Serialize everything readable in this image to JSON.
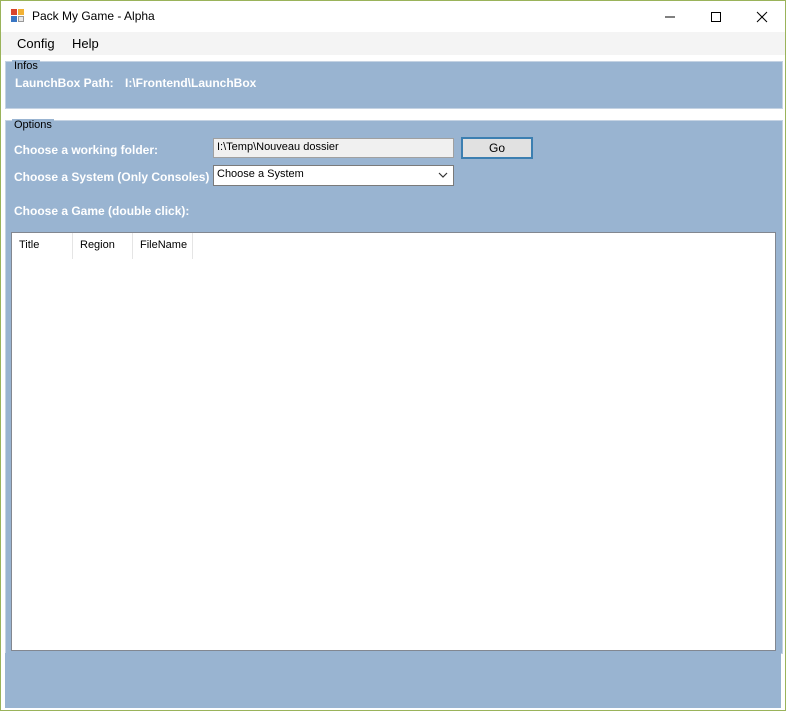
{
  "window": {
    "title": "Pack My Game - Alpha",
    "icon": "app-icon",
    "controls": {
      "minimize": "minimize-icon",
      "maximize": "maximize-icon",
      "close": "close-icon"
    }
  },
  "menu": {
    "items": [
      "Config",
      "Help"
    ]
  },
  "infos": {
    "legend": "Infos",
    "launchbox_label": "LaunchBox Path:",
    "launchbox_value": "I:\\Frontend\\LaunchBox"
  },
  "options": {
    "legend": "Options",
    "working_folder_label": "Choose a working folder:",
    "working_folder_value": "I:\\Temp\\Nouveau dossier",
    "go_label": "Go",
    "system_label": "Choose a System (Only Consoles)",
    "system_selected": "Choose a System",
    "game_label": "Choose a Game (double click):"
  },
  "games": {
    "columns": [
      "Title",
      "Region",
      "FileName"
    ],
    "rows": []
  },
  "colors": {
    "panel": "#99b4d1",
    "label_text": "#ffffff",
    "button_border": "#3c7fb1"
  }
}
